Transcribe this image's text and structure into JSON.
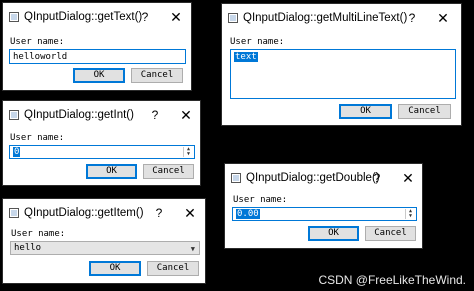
{
  "dialogs": {
    "get_text": {
      "title": "QInputDialog::getText()",
      "help": "?",
      "close": "✕",
      "label": "User name:",
      "value": "helloworld",
      "ok": "OK",
      "cancel": "Cancel"
    },
    "get_multiline_text": {
      "title": "QInputDialog::getMultiLineText()",
      "help": "?",
      "close": "✕",
      "label": "User name:",
      "value": "text",
      "ok": "OK",
      "cancel": "Cancel"
    },
    "get_int": {
      "title": "QInputDialog::getInt()",
      "help": "?",
      "close": "✕",
      "label": "User name:",
      "value": "0",
      "ok": "OK",
      "cancel": "Cancel"
    },
    "get_double": {
      "title": "QInputDialog::getDouble()",
      "help": "?",
      "close": "✕",
      "label": "User name:",
      "value": "0.00",
      "ok": "OK",
      "cancel": "Cancel"
    },
    "get_item": {
      "title": "QInputDialog::getItem()",
      "help": "?",
      "close": "✕",
      "label": "User name:",
      "value": "hello",
      "ok": "OK",
      "cancel": "Cancel"
    }
  },
  "watermark": "CSDN @FreeLikeTheWind."
}
